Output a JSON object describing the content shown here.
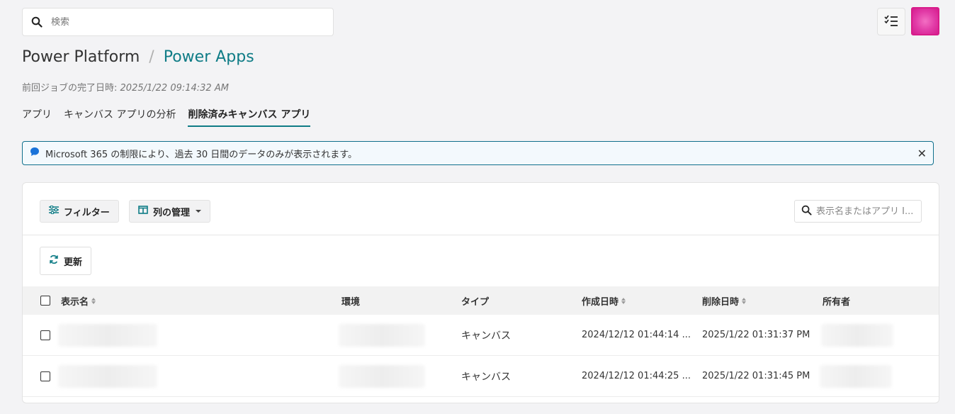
{
  "search": {
    "placeholder": "検索"
  },
  "header": {
    "tasks_icon": "checklist-icon",
    "avatar_color": "#e13aa6"
  },
  "breadcrumb": {
    "parent": "Power Platform",
    "separator": "/",
    "current": "Power Apps"
  },
  "last_job": {
    "label": "前回ジョブの完了日時:",
    "value": "2025/1/22 09:14:32 AM"
  },
  "tabs": [
    {
      "label": "アプリ",
      "active": false
    },
    {
      "label": "キャンバス アプリの分析",
      "active": false
    },
    {
      "label": "削除済みキャンバス アプリ",
      "active": true
    }
  ],
  "banner": {
    "message": "Microsoft 365 の制限により、過去 30 日間のデータのみが表示されます。",
    "close": "✕"
  },
  "toolbar": {
    "filter_label": "フィルター",
    "columns_label": "列の管理",
    "search_placeholder": "表示名またはアプリ I...",
    "refresh_label": "更新"
  },
  "table": {
    "columns": [
      "表示名",
      "環境",
      "タイプ",
      "作成日時",
      "削除日時",
      "所有者"
    ],
    "rows": [
      {
        "name": "",
        "environment": "",
        "type": "キャンバス",
        "created": "2024/12/12 01:44:14 ...",
        "deleted": "2025/1/22 01:31:37 PM",
        "owner": ""
      },
      {
        "name": "",
        "environment": "",
        "type": "キャンバス",
        "created": "2024/12/12 01:44:25 ...",
        "deleted": "2025/1/22 01:31:45 PM",
        "owner": ""
      }
    ]
  },
  "colors": {
    "accent": "#0f7c86",
    "banner_border": "#0f6f8c",
    "banner_icon": "#1a73d9"
  }
}
